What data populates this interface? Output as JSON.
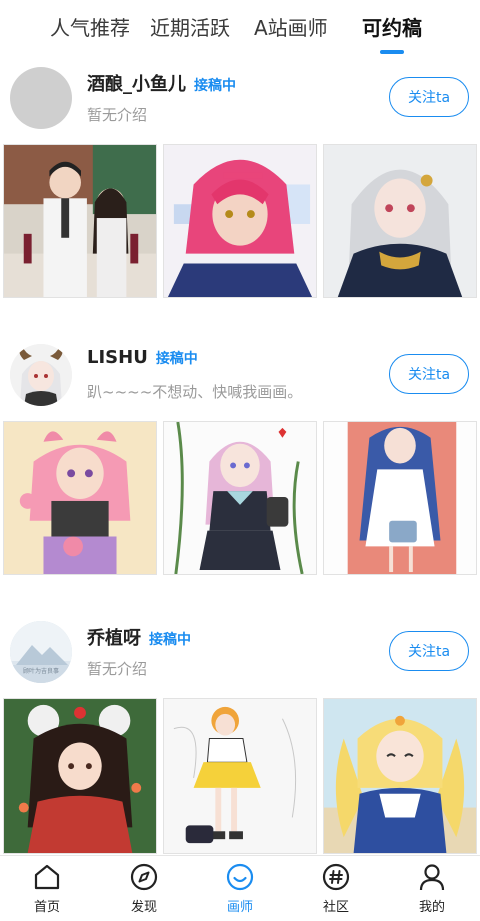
{
  "tabs": [
    {
      "label": "人气推荐",
      "active": false
    },
    {
      "label": "近期活跃",
      "active": false
    },
    {
      "label": "A站画师",
      "active": false
    },
    {
      "label": "可约稿",
      "active": true
    }
  ],
  "accent_color": "#1a8cf0",
  "artists": [
    {
      "name": "酒酿_小鱼儿",
      "badge": "接稿中",
      "intro": "暂无介绍",
      "follow_label": "关注ta",
      "avatar": "blank-avatar",
      "works": [
        "artwork-lab-couple",
        "artwork-pink-hair-boy",
        "artwork-silver-hair-girl"
      ]
    },
    {
      "name": "LISHU",
      "badge": "接稿中",
      "intro": "趴~~~~不想动、快喊我画画。",
      "follow_label": "关注ta",
      "avatar": "horned-girl-avatar",
      "works": [
        "artwork-pink-hair-kemonomimi",
        "artwork-sailor-uniform-girl",
        "artwork-blue-hair-girl"
      ]
    },
    {
      "name": "乔植呀",
      "badge": "接稿中",
      "intro": "暂无介绍",
      "follow_label": "关注ta",
      "avatar": "mountain-logo-avatar",
      "avatar_text": "顾叶为吉良事",
      "works": [
        "artwork-red-costume-girl",
        "artwork-sketch-yellow-skirt",
        "artwork-blonde-twin-tails"
      ]
    }
  ],
  "bottom_nav": [
    {
      "label": "首页",
      "icon": "home-icon",
      "active": false
    },
    {
      "label": "发现",
      "icon": "compass-icon",
      "active": false
    },
    {
      "label": "画师",
      "icon": "smile-icon",
      "active": true
    },
    {
      "label": "社区",
      "icon": "hashtag-icon",
      "active": false
    },
    {
      "label": "我的",
      "icon": "user-icon",
      "active": false
    }
  ]
}
